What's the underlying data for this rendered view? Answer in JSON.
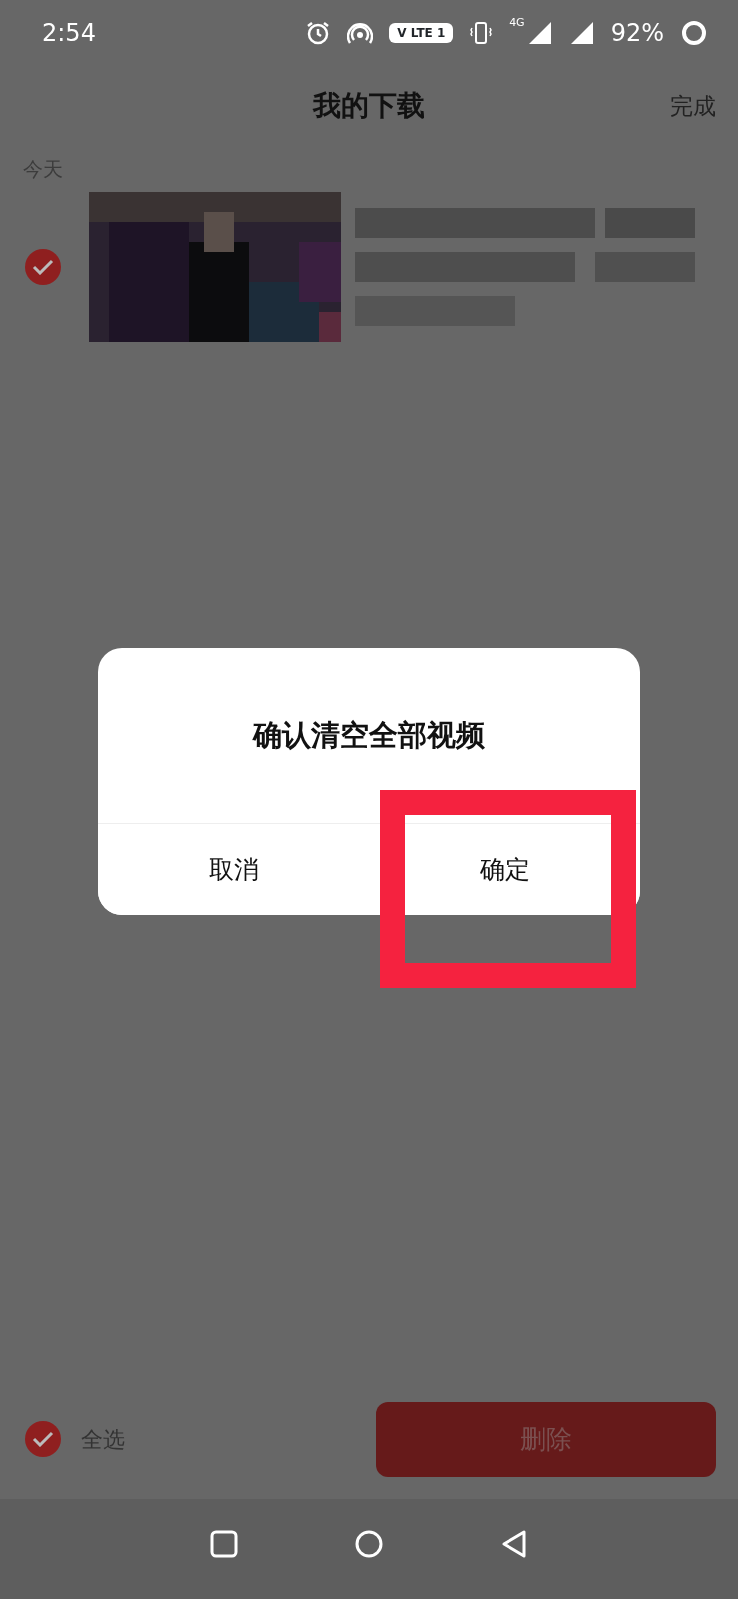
{
  "status_bar": {
    "time": "2:54",
    "volte": "V LTE 1",
    "network": "4G",
    "battery": "92%"
  },
  "header": {
    "title": "我的下载",
    "action": "完成"
  },
  "sections": [
    {
      "label": "今天",
      "items": [
        {
          "selected": true,
          "kind": "picture"
        }
      ]
    }
  ],
  "dialog": {
    "title": "确认清空全部视频",
    "buttons": [
      {
        "label": "取消",
        "highlighted": false
      },
      {
        "label": "确定",
        "highlighted": true
      }
    ]
  },
  "footer": {
    "select_all": {
      "label": "全选",
      "checked": true
    },
    "delete_button": "删除"
  }
}
